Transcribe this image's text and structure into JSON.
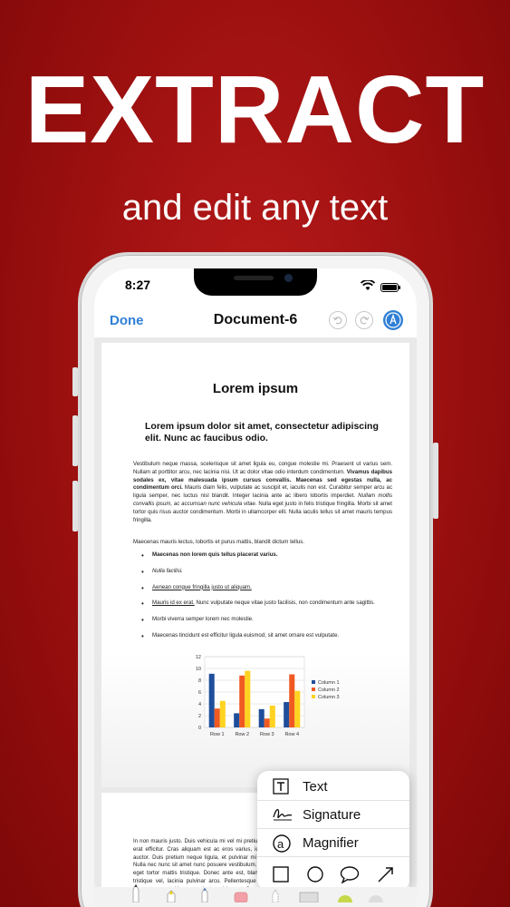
{
  "promo": {
    "headline": "EXTRACT",
    "subline": "and edit any text"
  },
  "status_bar": {
    "time": "8:27"
  },
  "nav": {
    "done_label": "Done",
    "title": "Document-6",
    "icons": [
      "undo-icon",
      "redo-icon",
      "markup-pen-icon"
    ]
  },
  "document": {
    "title": "Lorem ipsum",
    "subtitle": "Lorem ipsum dolor sit amet, consectetur adipiscing elit. Nunc ac faucibus odio.",
    "para1_a": "Vestibulum neque massa, scelerisque sit amet ligula eu, congue molestie mi. Praesent ut varius sem. Nullam at porttitor arcu, nec lacinia nisi. Ut ac dolor vitae odio interdum condimentum. ",
    "para1_b": "Vivamus dapibus sodales ex, vitae malesuada ipsum cursus convallis. Maecenas sed egestas nulla, ac condimentum orci.",
    "para1_c": " Mauris diam felis, vulputate ac suscipit et, iaculis non est. Curabitur semper arcu ac ligula semper, nec luctus nisl blandit. Integer lacinia ante ac libero lobortis imperdiet. ",
    "para1_d": "Nullam mollis convallis ipsum, ac accumsan nunc vehicula vitae.",
    "para1_e": " Nulla eget justo in felis tristique fringilla. Morbi sit amet tortor quis risus auctor condimentum. Morbi in ullamcorper elit. Nulla iaculis tellus sit amet mauris tempus fringilla.",
    "para2": "Maecenas mauris lectus, lobortis et purus mattis, blandit dictum tellus.",
    "bullets": [
      "Maecenas non lorem quis tellus placerat varius.",
      "Nulla facilisi.",
      "Aenean congue fringilla justo ut aliquam.",
      "Mauris id ex erat.",
      " Nunc vulputate neque vitae justo facilisis, non condimentum ante sagittis.",
      "Morbi viverra semper lorem nec molestie.",
      "Maecenas tincidunt est efficitur ligula euismod, sit amet ornare est vulputate."
    ],
    "page2_text": "In non mauris justo. Duis vehicula mi vel mi pretium, a viverra erat efficitur. Cras aliquam est ac eros varius, id iaculis dui auctor. Duis pretium neque ligula, et pulvinar mi placerat et. Nulla nec nunc sit amet nunc posuere vestibulum. Ut id neque eget tortor mattis tristique. Donec ante est, blandit sit amet tristique vel, lacinia pulvinar arcu. Pellentesque scelerisque fermentum erat, id posuere justo pulvinar ut. Cras id eros sed enim aliquam lobortis. Sed lobortis nisl ut eros efficitur tincidunt."
  },
  "chart_data": {
    "type": "bar",
    "categories": [
      "Row 1",
      "Row 2",
      "Row 3",
      "Row 4"
    ],
    "series": [
      {
        "name": "Column 1",
        "values": [
          9.1,
          2.4,
          3.1,
          4.3
        ],
        "color": "#1f4e9a"
      },
      {
        "name": "Column 2",
        "values": [
          3.2,
          8.8,
          1.5,
          9.0
        ],
        "color": "#f05a22"
      },
      {
        "name": "Column 3",
        "values": [
          4.5,
          9.6,
          3.7,
          6.2
        ],
        "color": "#ffd320"
      }
    ],
    "ylim": [
      0,
      12
    ],
    "yticks": [
      "0",
      "2",
      "4",
      "6",
      "8",
      "10",
      "12"
    ],
    "grid": true,
    "legend": "right"
  },
  "popover": {
    "items": [
      {
        "label": "Text",
        "icon": "text-box-icon"
      },
      {
        "label": "Signature",
        "icon": "signature-icon"
      },
      {
        "label": "Magnifier",
        "icon": "magnifier-icon"
      }
    ],
    "shapes": [
      "square-icon",
      "circle-icon",
      "speech-bubble-icon",
      "arrow-icon"
    ]
  }
}
